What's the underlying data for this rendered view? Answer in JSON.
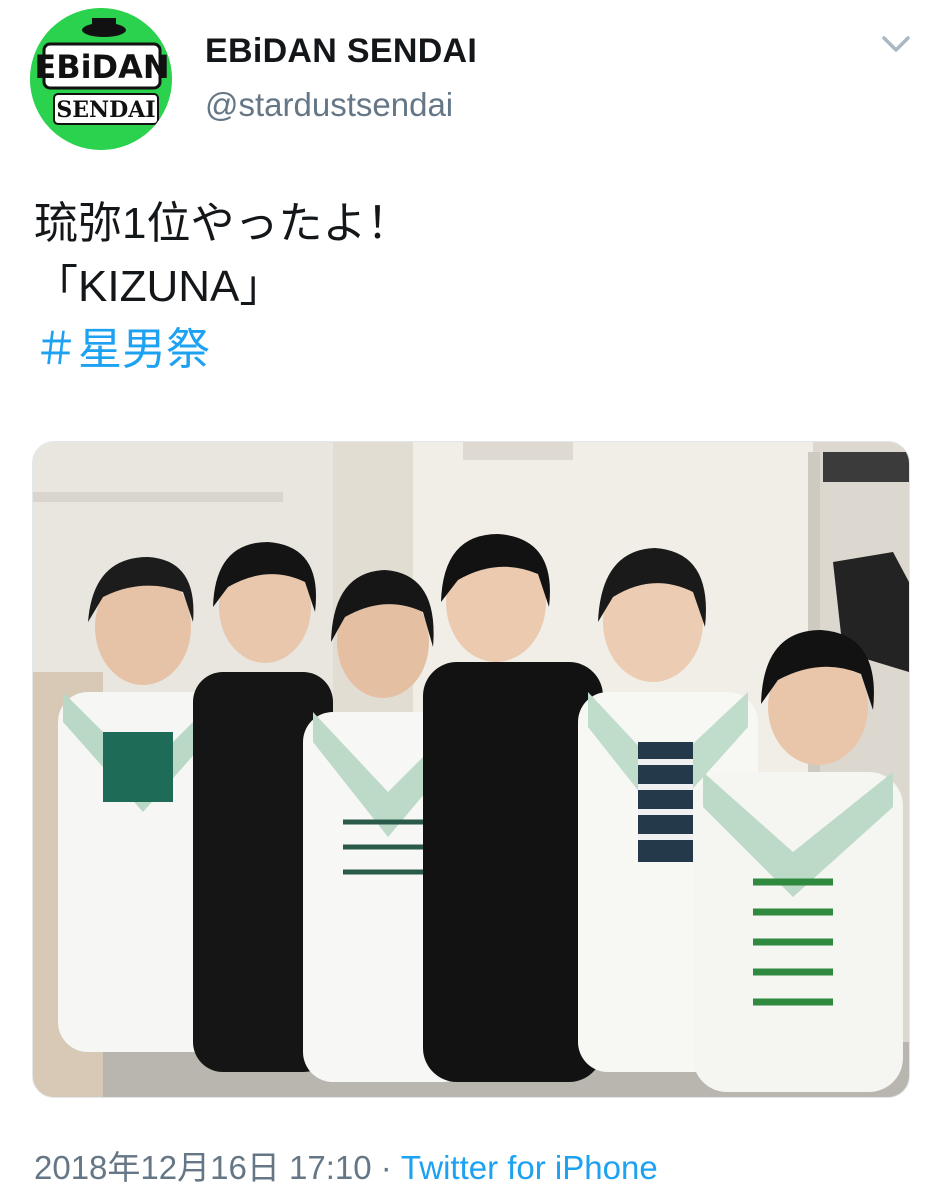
{
  "account": {
    "display_name": "EBiDAN SENDAI",
    "handle": "@stardustsendai",
    "avatar": {
      "icon": "ebidan-sendai-logo",
      "logo_text_top": "EBiDAN",
      "logo_text_bottom": "SENDAI",
      "background": "#2ad24e"
    }
  },
  "menu": {
    "icon": "chevron-down-icon"
  },
  "tweet": {
    "lines": [
      "琉弥1位やったよ！",
      "「KIZUNA」"
    ],
    "hashtag": "＃星男祭"
  },
  "media": {
    "type": "photo",
    "icon": "photo-six-boys-backstage"
  },
  "meta": {
    "timestamp": "2018年12月16日 17:10",
    "separator": " · ",
    "source": "Twitter for iPhone"
  },
  "colors": {
    "link": "#1da1f2",
    "text": "#14171a",
    "secondary": "#657786"
  }
}
